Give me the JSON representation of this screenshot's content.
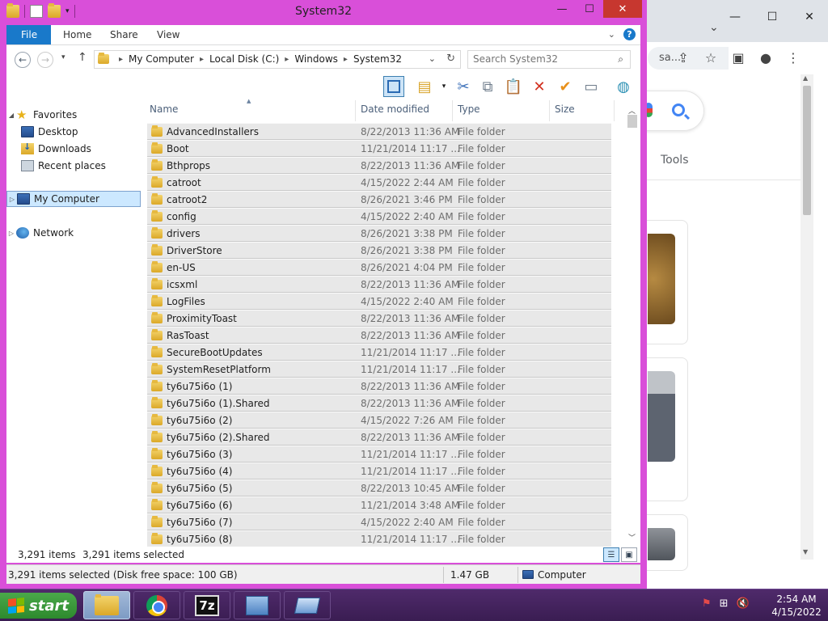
{
  "chrome": {
    "omnibox_text": "sa...",
    "tools_label": "Tools"
  },
  "explorer": {
    "title": "System32",
    "ribbon_tabs": [
      "File",
      "Home",
      "Share",
      "View"
    ],
    "breadcrumbs": [
      "My Computer",
      "Local Disk (C:)",
      "Windows",
      "System32"
    ],
    "search_placeholder": "Search System32",
    "nav": {
      "favorites": "Favorites",
      "desktop": "Desktop",
      "downloads": "Downloads",
      "recent": "Recent places",
      "my_computer": "My Computer",
      "network": "Network"
    },
    "columns": {
      "name": "Name",
      "date": "Date modified",
      "type": "Type",
      "size": "Size"
    },
    "rows": [
      {
        "name": "AdvancedInstallers",
        "date": "8/22/2013 11:36 AM",
        "type": "File folder"
      },
      {
        "name": "Boot",
        "date": "11/21/2014 11:17 ...",
        "type": "File folder"
      },
      {
        "name": "Bthprops",
        "date": "8/22/2013 11:36 AM",
        "type": "File folder"
      },
      {
        "name": "catroot",
        "date": "4/15/2022 2:44 AM",
        "type": "File folder"
      },
      {
        "name": "catroot2",
        "date": "8/26/2021 3:46 PM",
        "type": "File folder"
      },
      {
        "name": "config",
        "date": "4/15/2022 2:40 AM",
        "type": "File folder"
      },
      {
        "name": "drivers",
        "date": "8/26/2021 3:38 PM",
        "type": "File folder"
      },
      {
        "name": "DriverStore",
        "date": "8/26/2021 3:38 PM",
        "type": "File folder"
      },
      {
        "name": "en-US",
        "date": "8/26/2021 4:04 PM",
        "type": "File folder"
      },
      {
        "name": "icsxml",
        "date": "8/22/2013 11:36 AM",
        "type": "File folder"
      },
      {
        "name": "LogFiles",
        "date": "4/15/2022 2:40 AM",
        "type": "File folder"
      },
      {
        "name": "ProximityToast",
        "date": "8/22/2013 11:36 AM",
        "type": "File folder"
      },
      {
        "name": "RasToast",
        "date": "8/22/2013 11:36 AM",
        "type": "File folder"
      },
      {
        "name": "SecureBootUpdates",
        "date": "11/21/2014 11:17 ...",
        "type": "File folder"
      },
      {
        "name": "SystemResetPlatform",
        "date": "11/21/2014 11:17 ...",
        "type": "File folder"
      },
      {
        "name": "ty6u75i6o (1)",
        "date": "8/22/2013 11:36 AM",
        "type": "File folder"
      },
      {
        "name": "ty6u75i6o (1).Shared",
        "date": "8/22/2013 11:36 AM",
        "type": "File folder"
      },
      {
        "name": "ty6u75i6o (2)",
        "date": "4/15/2022 7:26 AM",
        "type": "File folder"
      },
      {
        "name": "ty6u75i6o (2).Shared",
        "date": "8/22/2013 11:36 AM",
        "type": "File folder"
      },
      {
        "name": "ty6u75i6o (3)",
        "date": "11/21/2014 11:17 ...",
        "type": "File folder"
      },
      {
        "name": "ty6u75i6o (4)",
        "date": "11/21/2014 11:17 ...",
        "type": "File folder"
      },
      {
        "name": "ty6u75i6o (5)",
        "date": "8/22/2013 10:45 AM",
        "type": "File folder"
      },
      {
        "name": "ty6u75i6o (6)",
        "date": "11/21/2014 3:48 AM",
        "type": "File folder"
      },
      {
        "name": "ty6u75i6o (7)",
        "date": "4/15/2022 2:40 AM",
        "type": "File folder"
      },
      {
        "name": "ty6u75i6o (8)",
        "date": "11/21/2014 11:17 ...",
        "type": "File folder"
      }
    ],
    "status": {
      "items_count": "3,291 items",
      "items_selected": "3,291 items selected",
      "detail": "3,291 items selected (Disk free space: 100 GB)",
      "size": "1.47 GB",
      "location": "Computer"
    }
  },
  "taskbar": {
    "start_label": "start",
    "sevenzip_label": "7z",
    "time": "2:54 AM",
    "date": "4/15/2022"
  },
  "colors": {
    "window_frame": "#d94fd9",
    "file_tab": "#1979ca",
    "close_button": "#c7372f",
    "row_bg": "#e8e8e8",
    "taskbar": "#3a1d52",
    "start_button": "#2d8a2d"
  }
}
